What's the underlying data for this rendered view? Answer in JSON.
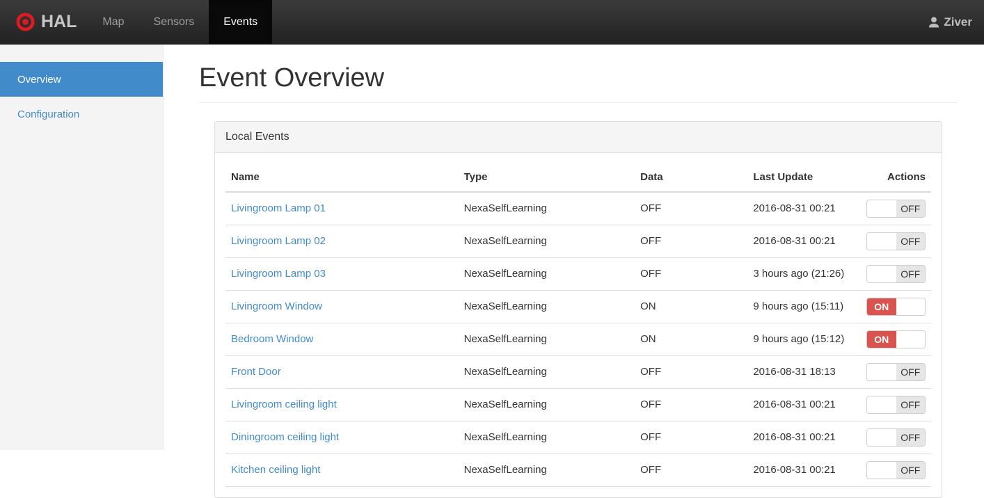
{
  "navbar": {
    "brand": "HAL",
    "items": [
      {
        "label": "Map",
        "active": false
      },
      {
        "label": "Sensors",
        "active": false
      },
      {
        "label": "Events",
        "active": true
      }
    ],
    "user": {
      "name": "Ziver"
    }
  },
  "sidebar": {
    "items": [
      {
        "label": "Overview",
        "active": true
      },
      {
        "label": "Configuration",
        "active": false
      }
    ]
  },
  "page": {
    "title": "Event Overview"
  },
  "panel": {
    "title": "Local Events"
  },
  "events_table": {
    "columns": [
      "Name",
      "Type",
      "Data",
      "Last Update",
      "Actions"
    ],
    "rows": [
      {
        "name": "Livingroom Lamp 01",
        "type": "NexaSelfLearning",
        "data": "OFF",
        "last_update": "2016-08-31 00:21",
        "switch": "OFF"
      },
      {
        "name": "Livingroom Lamp 02",
        "type": "NexaSelfLearning",
        "data": "OFF",
        "last_update": "2016-08-31 00:21",
        "switch": "OFF"
      },
      {
        "name": "Livingroom Lamp 03",
        "type": "NexaSelfLearning",
        "data": "OFF",
        "last_update": "3 hours ago (21:26)",
        "switch": "OFF"
      },
      {
        "name": "Livingroom Window",
        "type": "NexaSelfLearning",
        "data": "ON",
        "last_update": "9 hours ago (15:11)",
        "switch": "ON"
      },
      {
        "name": "Bedroom Window",
        "type": "NexaSelfLearning",
        "data": "ON",
        "last_update": "9 hours ago (15:12)",
        "switch": "ON"
      },
      {
        "name": "Front Door",
        "type": "NexaSelfLearning",
        "data": "OFF",
        "last_update": "2016-08-31 18:13",
        "switch": "OFF"
      },
      {
        "name": "Livingroom ceiling light",
        "type": "NexaSelfLearning",
        "data": "OFF",
        "last_update": "2016-08-31 00:21",
        "switch": "OFF"
      },
      {
        "name": "Diningroom ceiling light",
        "type": "NexaSelfLearning",
        "data": "OFF",
        "last_update": "2016-08-31 00:21",
        "switch": "OFF"
      },
      {
        "name": "Kitchen ceiling light",
        "type": "NexaSelfLearning",
        "data": "OFF",
        "last_update": "2016-08-31 00:21",
        "switch": "OFF"
      }
    ]
  },
  "colors": {
    "accent_blue": "#428bca",
    "danger_red": "#d9534f",
    "brand_red": "#dd1b22",
    "navbar_bg": "#222222",
    "switch_off_bg": "#e6e6e6"
  }
}
